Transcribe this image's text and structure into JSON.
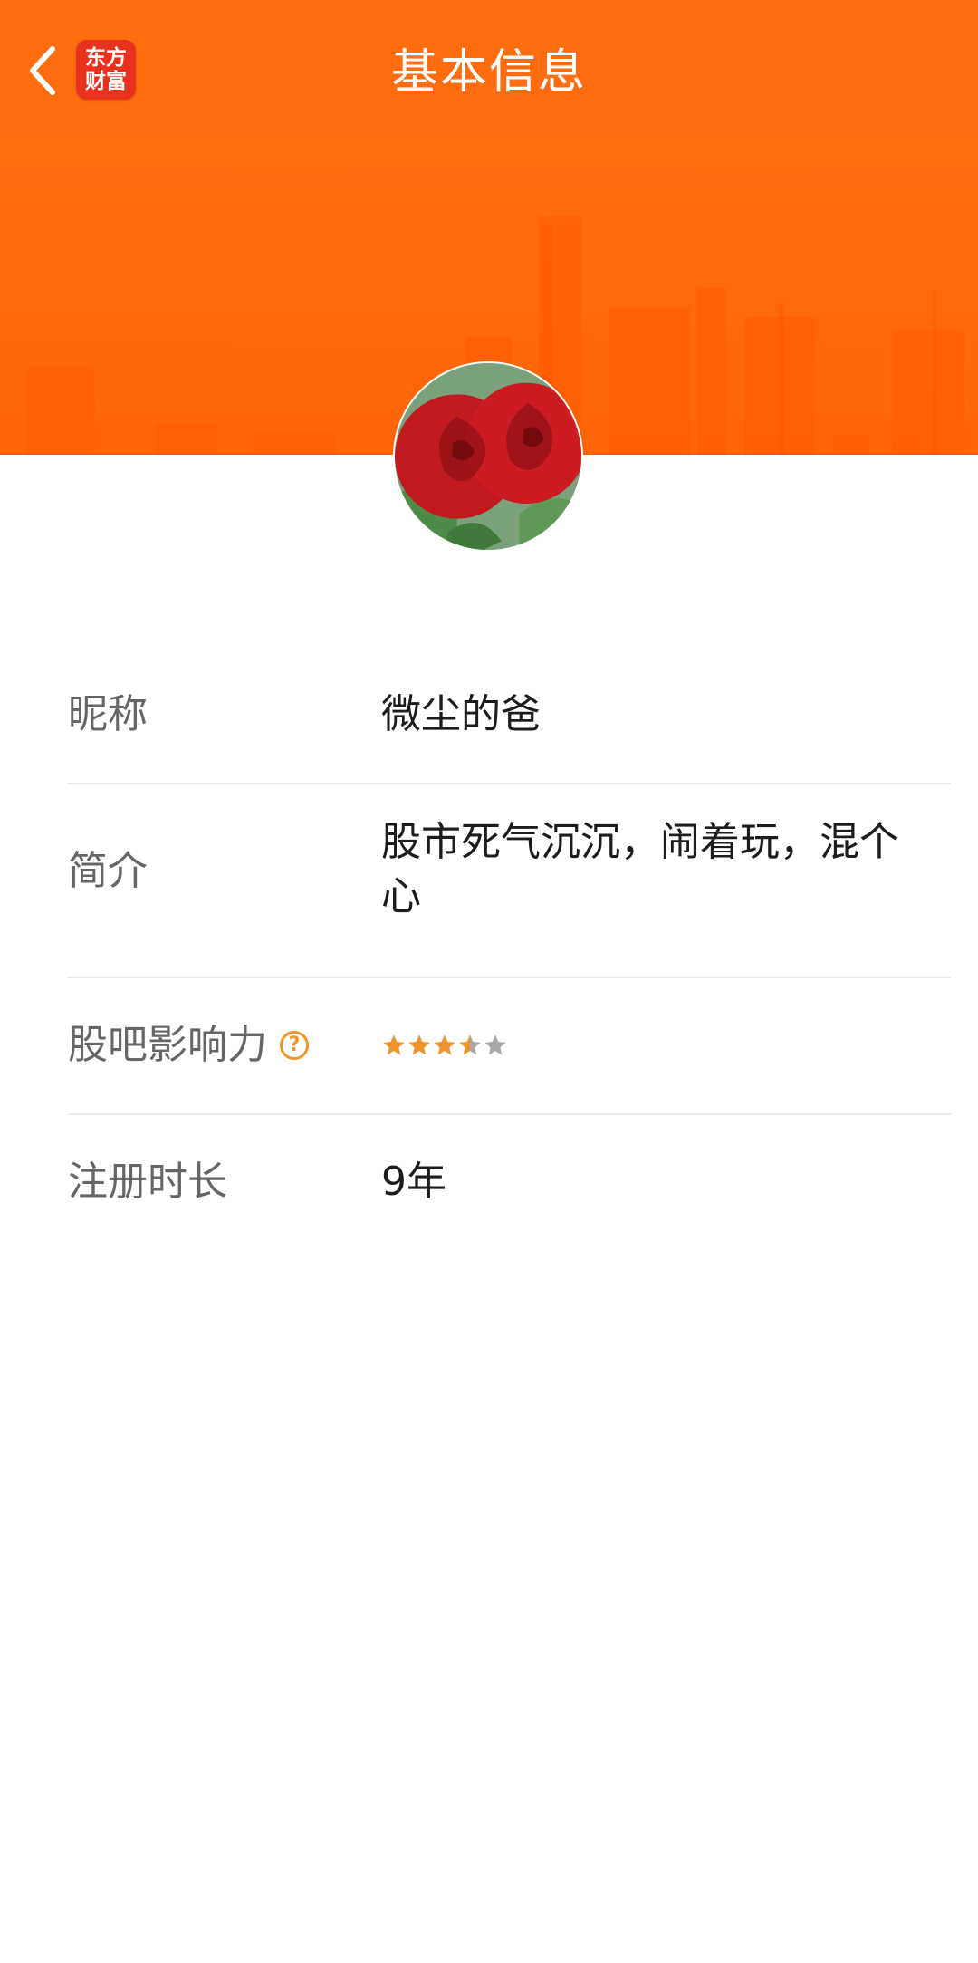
{
  "header": {
    "title": "基本信息",
    "logo_line1": "东方",
    "logo_line2": "财富",
    "background_color": "#ff6a0c"
  },
  "profile": {
    "rows": [
      {
        "label": "昵称",
        "value": "微尘的爸"
      },
      {
        "label": "简介",
        "value": "股市死气沉沉，闹着玩，混个心"
      },
      {
        "label": "股吧影响力",
        "value": null,
        "rating": 3.5,
        "max_rating": 5
      },
      {
        "label": "注册时长",
        "value": "9年"
      }
    ]
  },
  "icons": {
    "back": "chevron-left-icon",
    "help": "question-circle-icon",
    "star": "star-icon"
  },
  "colors": {
    "star_active": "#f0952c",
    "star_inactive": "#a8a8a8",
    "label": "#666666",
    "value": "#1c1c1c"
  }
}
